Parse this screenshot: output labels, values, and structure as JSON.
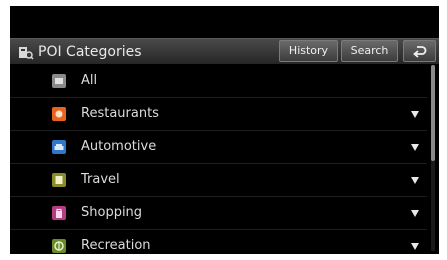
{
  "header": {
    "title": "POI Categories",
    "title_icon": "poi-categories-icon",
    "history_label": "History",
    "search_label": "Search",
    "back_icon": "back-arrow-icon"
  },
  "categories": [
    {
      "label": "All",
      "icon": "all-icon",
      "color": "#8a8a8a",
      "expandable": false
    },
    {
      "label": "Restaurants",
      "icon": "restaurant-icon",
      "color": "#e8641e",
      "expandable": true
    },
    {
      "label": "Automotive",
      "icon": "car-icon",
      "color": "#2f78c8",
      "expandable": true
    },
    {
      "label": "Travel",
      "icon": "travel-icon",
      "color": "#8a8a2a",
      "expandable": true
    },
    {
      "label": "Shopping",
      "icon": "shopping-icon",
      "color": "#b43c82",
      "expandable": true
    },
    {
      "label": "Recreation",
      "icon": "recreation-icon",
      "color": "#6a8a2a",
      "expandable": true
    }
  ],
  "colors": {
    "background": "#000000",
    "header": "#3a3a3a",
    "text": "#dcdcdc"
  }
}
